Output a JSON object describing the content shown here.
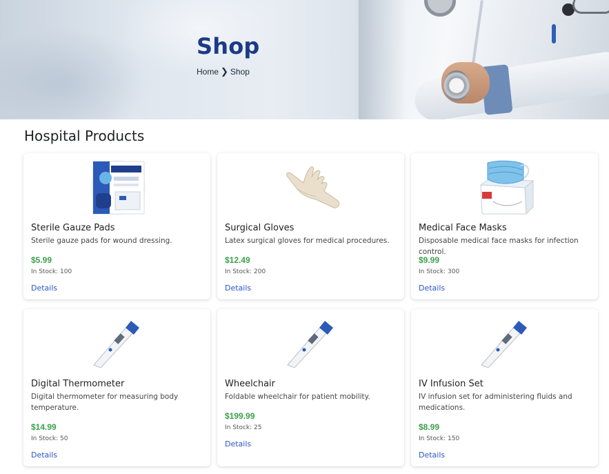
{
  "hero": {
    "title": "Shop",
    "breadcrumb": {
      "home": "Home",
      "separator": "❯",
      "current": "Shop"
    }
  },
  "section": {
    "title": "Hospital Products"
  },
  "products": [
    {
      "name": "Sterile Gauze Pads",
      "description": "Sterile gauze pads for wound dressing.",
      "price": "$5.99",
      "stock": "In Stock: 100",
      "details": "Details",
      "icon": "gauze-pads-image"
    },
    {
      "name": "Surgical Gloves",
      "description": "Latex surgical gloves for medical procedures.",
      "price": "$12.49",
      "stock": "In Stock: 200",
      "details": "Details",
      "icon": "surgical-gloves-image"
    },
    {
      "name": "Medical Face Masks",
      "description": "Disposable medical face masks for infection control.",
      "price": "$9.99",
      "stock": "In Stock: 300",
      "details": "Details",
      "icon": "face-masks-image"
    },
    {
      "name": "Digital Thermometer",
      "description": "Digital thermometer for measuring body temperature.",
      "price": "$14.99",
      "stock": "In Stock: 50",
      "details": "Details",
      "icon": "thermometer-image"
    },
    {
      "name": "Wheelchair",
      "description": "Foldable wheelchair for patient mobility.",
      "price": "$199.99",
      "stock": "In Stock: 25",
      "details": "Details",
      "icon": "thermometer-image"
    },
    {
      "name": "IV Infusion Set",
      "description": "IV infusion set for administering fluids and medications.",
      "price": "$8.99",
      "stock": "In Stock: 150",
      "details": "Details",
      "icon": "thermometer-image"
    }
  ],
  "colors": {
    "title": "#1d3a86",
    "price": "#3aa14a",
    "link": "#2b55c9"
  }
}
